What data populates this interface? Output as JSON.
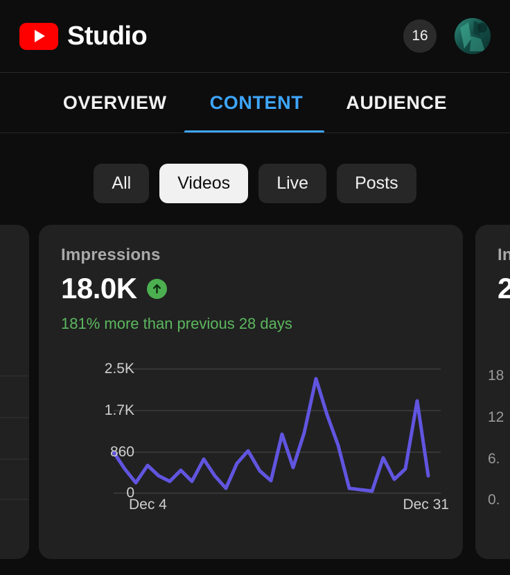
{
  "header": {
    "brand_name": "Studio",
    "logo_icon": "youtube-play-icon",
    "notification_count": "16",
    "avatar_icon": "user-avatar"
  },
  "tabs": [
    {
      "label": "OVERVIEW",
      "active": false
    },
    {
      "label": "CONTENT",
      "active": true
    },
    {
      "label": "AUDIENCE",
      "active": false
    }
  ],
  "filter_chips": [
    {
      "label": "All",
      "selected": false
    },
    {
      "label": "Videos",
      "selected": true
    },
    {
      "label": "Live",
      "selected": false
    },
    {
      "label": "Posts",
      "selected": false
    }
  ],
  "main_card": {
    "metric_title": "Impressions",
    "metric_value": "18.0K",
    "trend_direction": "up",
    "trend_icon": "arrow-up-icon",
    "trend_text": "181% more than previous 28 days",
    "trend_color": "#5bb85f",
    "accent_color": "#6155e0"
  },
  "next_card": {
    "metric_title": "In",
    "metric_value": "2",
    "y_labels": [
      "18",
      "12",
      "6.",
      "0."
    ]
  },
  "colors": {
    "page_background": "#0d0d0d",
    "card_background": "#212121",
    "tab_active": "#3ea6ff",
    "chip_selected_bg": "#f1f1f1",
    "brand_red": "#ff0000",
    "line_purple": "#6155e0",
    "trend_green": "#4caf50",
    "gridline": "#4a4a4a"
  },
  "chart_data": {
    "type": "line",
    "title": "Impressions",
    "xlabel": "",
    "ylabel": "",
    "x_tick_labels": [
      "Dec 4",
      "Dec 31"
    ],
    "y_tick_labels": [
      "0",
      "860",
      "1.7K",
      "2.5K"
    ],
    "y_tick_values": [
      0,
      860,
      1700,
      2500
    ],
    "ylim": [
      0,
      2500
    ],
    "grid": true,
    "legend": "none",
    "series": [
      {
        "name": "Impressions",
        "color": "#6155e0",
        "x": [
          "Dec 4",
          "Dec 5",
          "Dec 6",
          "Dec 7",
          "Dec 8",
          "Dec 9",
          "Dec 10",
          "Dec 11",
          "Dec 12",
          "Dec 13",
          "Dec 14",
          "Dec 15",
          "Dec 16",
          "Dec 17",
          "Dec 18",
          "Dec 19",
          "Dec 20",
          "Dec 21",
          "Dec 22",
          "Dec 23",
          "Dec 24",
          "Dec 25",
          "Dec 26",
          "Dec 27",
          "Dec 28",
          "Dec 29",
          "Dec 30",
          "Dec 31"
        ],
        "values": [
          860,
          520,
          300,
          660,
          480,
          340,
          260,
          400,
          270,
          780,
          300,
          180,
          600,
          900,
          430,
          260,
          1080,
          460,
          1150,
          2320,
          1500,
          800,
          150,
          130,
          110,
          620,
          280,
          420,
          1760,
          600
        ]
      }
    ]
  }
}
